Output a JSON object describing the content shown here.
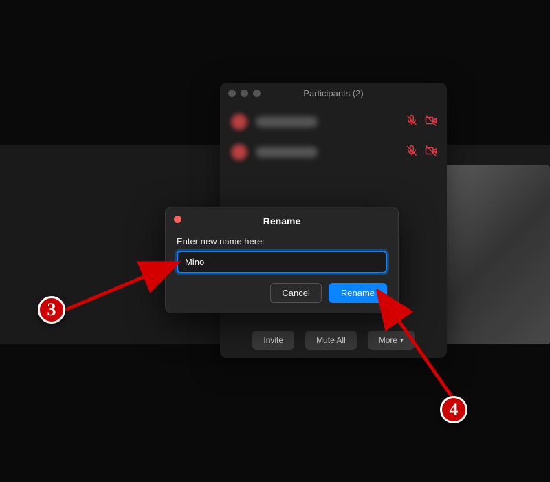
{
  "participants_panel": {
    "title": "Participants (2)",
    "rows": [
      {
        "mic_muted": true,
        "cam_off": true
      },
      {
        "mic_muted": true,
        "cam_off": true
      }
    ],
    "footer": {
      "invite": "Invite",
      "mute_all": "Mute All",
      "more": "More"
    }
  },
  "rename_dialog": {
    "title": "Rename",
    "label": "Enter new name here:",
    "value": "Mino",
    "cancel": "Cancel",
    "confirm": "Rename"
  },
  "annotations": {
    "step3": "3",
    "step4": "4"
  },
  "colors": {
    "accent": "#0a84ff",
    "danger": "#e63946",
    "badge": "#cc0000"
  }
}
